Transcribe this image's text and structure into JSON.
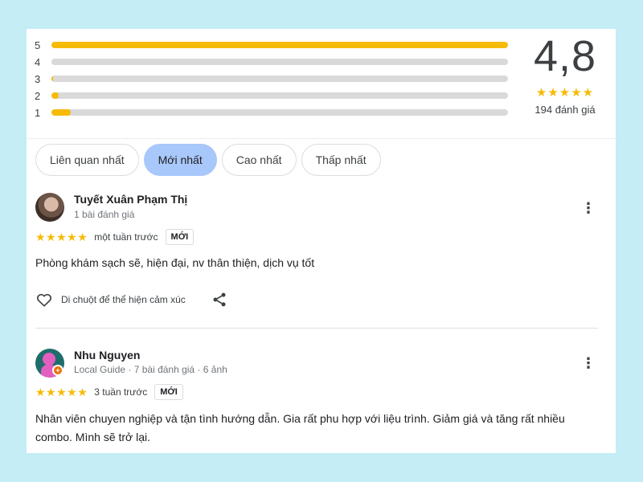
{
  "rating_summary": {
    "histogram": [
      {
        "label": "5",
        "fraction": 1.0
      },
      {
        "label": "4",
        "fraction": 0.0
      },
      {
        "label": "3",
        "fraction": 0.004
      },
      {
        "label": "2",
        "fraction": 0.015
      },
      {
        "label": "1",
        "fraction": 0.042
      }
    ],
    "average": "4,8",
    "stars": "★★★★★",
    "count": "194 đánh giá",
    "colors": {
      "bar_fill": "#f6bb06",
      "bar_track": "#d9d9d9"
    }
  },
  "sort_chips": [
    {
      "label": "Liên quan nhất",
      "active": false
    },
    {
      "label": "Mới nhất",
      "active": true
    },
    {
      "label": "Cao nhất",
      "active": false
    },
    {
      "label": "Thấp nhất",
      "active": false
    }
  ],
  "reviews": [
    {
      "author": "Tuyết Xuân Phạm Thị",
      "meta": "1 bài đánh giá",
      "stars": "★★★★★",
      "time": "một tuần trước",
      "badge": "MỚI",
      "text": "Phòng khám sạch sẽ, hiện đại, nv thân thiện, dịch vụ tốt",
      "reaction_label": "Di chuột để thể hiện cảm xúc",
      "more_icon": "⋮"
    },
    {
      "author": "Nhu Nguyen",
      "meta": "Local Guide · 7 bài đánh giá · 6 ảnh",
      "stars": "★★★★★",
      "time": "3 tuần trước",
      "badge": "MỚI",
      "text": "Nhân viên chuyen nghiệp và tận tình hướng dẫn. Gia rất phu hợp với liệu trình. Giảm giá và tăng rất nhiều combo. Mình sẽ trở lại.",
      "more_icon": "⋮"
    }
  ]
}
